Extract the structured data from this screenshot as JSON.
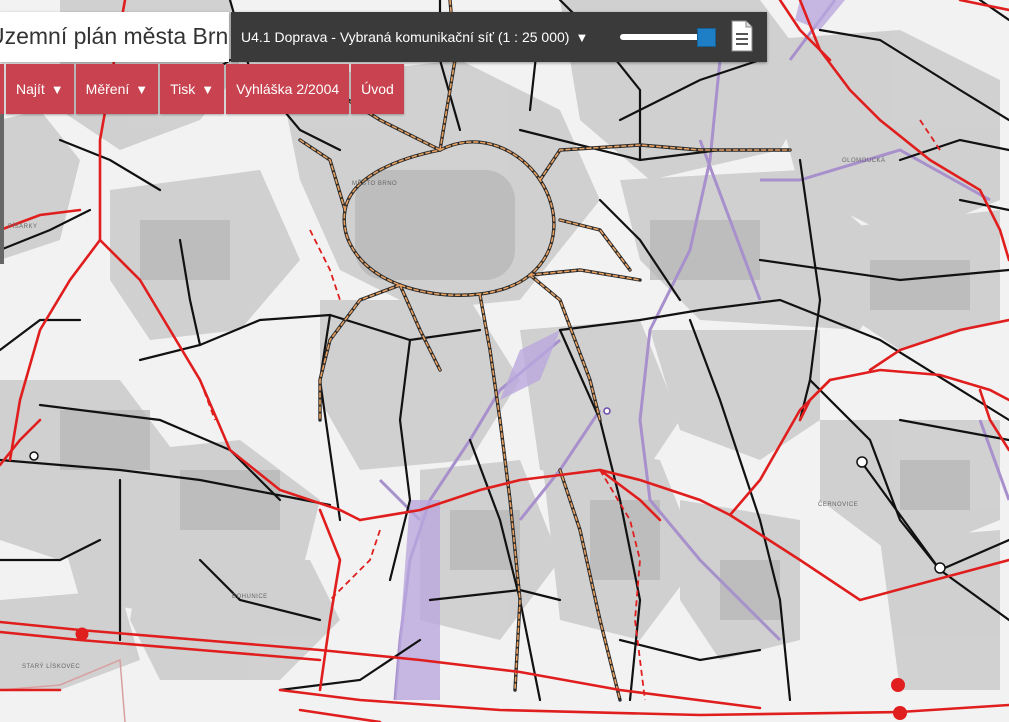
{
  "app": {
    "title": "Územní plán města Brna"
  },
  "layer_bar": {
    "selected_layer": "U4.1 Doprava - Vybraná komunikační síť (1 : 25 000)",
    "caret": "▼",
    "opacity_level": 1.0,
    "legend_icon": "document-icon"
  },
  "menu": {
    "items": [
      {
        "label": "Najít",
        "caret": "▼"
      },
      {
        "label": "Měření",
        "caret": "▼"
      },
      {
        "label": "Tisk",
        "caret": "▼"
      },
      {
        "label": "Vyhláška 2/2004",
        "caret": ""
      },
      {
        "label": "Úvod",
        "caret": ""
      }
    ]
  },
  "map": {
    "place_labels": [
      "MĚSTO BRNO",
      "PÍSÁRKY",
      "ČERNOVICE",
      "BOHUNICE",
      "STARÝ LÍSKOVEC",
      "OLOMOUCKÁ"
    ],
    "colors": {
      "background": "#f2f2f2",
      "built_area": "#c8c8c8",
      "main_road": "#e01e1e",
      "local_road": "#111111",
      "tram_dashed": "#e8a060",
      "rail": "#a890cc",
      "boundary": "#d8a0a0"
    }
  }
}
